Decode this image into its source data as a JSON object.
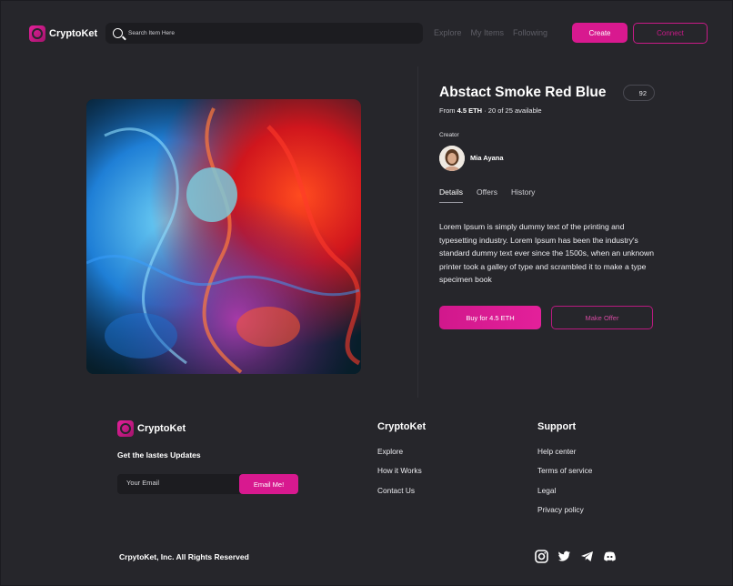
{
  "header": {
    "logo_text": "CryptoKet",
    "search_placeholder": "Search Item Here",
    "nav": [
      "Explore",
      "My Items",
      "Following"
    ],
    "create_label": "Create",
    "connect_label": "Connect"
  },
  "nft": {
    "title": "Abstact Smoke Red Blue",
    "likes": "92",
    "price_prefix": "From",
    "price": "4.5 ETH",
    "availability": "20 of 25 available",
    "creator_label": "Creator",
    "creator_name": "Mia Ayana",
    "tabs": [
      "Details",
      "Offers",
      "History"
    ],
    "description": "Lorem Ipsum is simply dummy text of the printing and typesetting industry. Lorem Ipsum has been the industry's standard dummy text ever since the 1500s, when an unknown printer took a galley of type and scrambled it to make a type specimen book",
    "buy_label": "Buy for 4.5 ETH",
    "offer_label": "Make Offer"
  },
  "footer": {
    "logo_text": "CryptoKet",
    "updates_heading": "Get the lastes Updates",
    "email_placeholder": "Your Email",
    "email_button": "Email Me!",
    "col1_title": "CryptoKet",
    "col1_links": [
      "Explore",
      "How it Works",
      "Contact Us"
    ],
    "col2_title": "Support",
    "col2_links": [
      "Help center",
      "Terms of service",
      "Legal",
      "Privacy policy"
    ],
    "copyright": "CrpytoKet, Inc. All Rights Reserved",
    "socials": [
      "instagram-icon",
      "twitter-icon",
      "telegram-icon",
      "discord-icon"
    ]
  },
  "colors": {
    "accent": "#d8198f",
    "background": "#26262b"
  }
}
